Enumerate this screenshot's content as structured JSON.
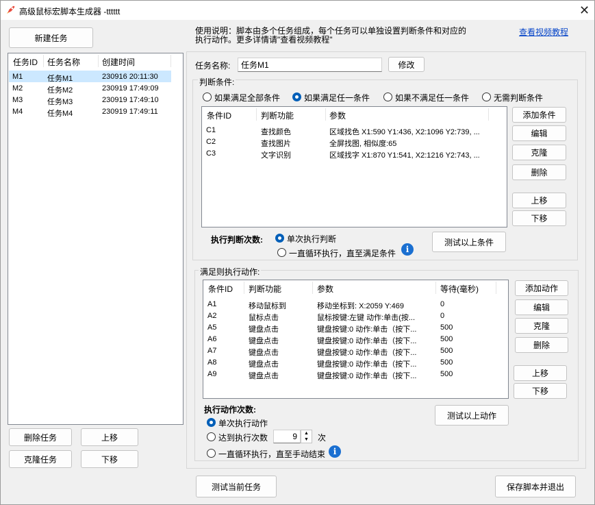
{
  "window": {
    "title": "高级鼠标宏脚本生成器 -tttttt",
    "close": "✕"
  },
  "left": {
    "new_task": "新建任务",
    "columns": [
      "任务ID",
      "任务名称",
      "创建时间"
    ],
    "tasks": [
      {
        "id": "M1",
        "name": "任务M1",
        "time": "230916 20:11:30",
        "selected": true
      },
      {
        "id": "M2",
        "name": "任务M2",
        "time": "230919 17:49:09"
      },
      {
        "id": "M3",
        "name": "任务M3",
        "time": "230919 17:49:10"
      },
      {
        "id": "M4",
        "name": "任务M4",
        "time": "230919 17:49:11"
      }
    ],
    "delete": "删除任务",
    "move_up": "上移",
    "clone": "克隆任务",
    "move_down": "下移"
  },
  "help": {
    "line1": "使用说明：脚本由多个任务组成，每个任务可以单独设置判断条件和对应的",
    "line2": "执行动作。更多详情请\"查看视频教程\"",
    "video_link": "查看视频教程"
  },
  "task": {
    "name_label": "任务名称:",
    "name_value": "任务M1",
    "modify": "修改"
  },
  "conditions": {
    "title": "判断条件:",
    "modes": [
      "如果满足全部条件",
      "如果满足任一条件",
      "如果不满足任一条件",
      "无需判断条件"
    ],
    "selected_mode": 1,
    "columns": [
      "条件ID",
      "判断功能",
      "参数"
    ],
    "rows": [
      {
        "id": "C1",
        "func": "查找颜色",
        "param": "区域找色 X1:590 Y1:436, X2:1096 Y2:739, ..."
      },
      {
        "id": "C2",
        "func": "查找图片",
        "param": "全屏找图, 相似度:65"
      },
      {
        "id": "C3",
        "func": "文字识别",
        "param": "区域找字 X1:870 Y1:541, X2:1216 Y2:743, ..."
      }
    ],
    "add": "添加条件",
    "edit": "编辑",
    "clone": "克隆",
    "delete": "删除",
    "up": "上移",
    "down": "下移",
    "exec_label": "执行判断次数:",
    "exec_once": "单次执行判断",
    "exec_loop": "一直循环执行，直至满足条件",
    "test": "测试以上条件"
  },
  "actions": {
    "title": "满足则执行动作:",
    "columns": [
      "条件ID",
      "判断功能",
      "参数",
      "等待(毫秒)"
    ],
    "rows": [
      {
        "id": "A1",
        "func": "移动鼠标到",
        "param": "移动坐标到: X:2059 Y:469",
        "wait": "0"
      },
      {
        "id": "A2",
        "func": "鼠标点击",
        "param": "鼠标按键:左键 动作:单击(按...",
        "wait": "0"
      },
      {
        "id": "A5",
        "func": "键盘点击",
        "param": "键盘按键:0 动作:单击（按下...",
        "wait": "500"
      },
      {
        "id": "A6",
        "func": "键盘点击",
        "param": "键盘按键:0 动作:单击（按下...",
        "wait": "500"
      },
      {
        "id": "A7",
        "func": "键盘点击",
        "param": "键盘按键:0 动作:单击（按下...",
        "wait": "500"
      },
      {
        "id": "A8",
        "func": "键盘点击",
        "param": "键盘按键:0 动作:单击（按下...",
        "wait": "500"
      },
      {
        "id": "A9",
        "func": "键盘点击",
        "param": "键盘按键:0 动作:单击（按下...",
        "wait": "500"
      }
    ],
    "add": "添加动作",
    "edit": "编辑",
    "clone": "克隆",
    "delete": "删除",
    "up": "上移",
    "down": "下移",
    "exec_label": "执行动作次数:",
    "exec_once": "单次执行动作",
    "exec_count": "达到执行次数",
    "count_value": "9",
    "count_unit": "次",
    "exec_loop": "一直循环执行，直至手动结束",
    "selected_mode": 0,
    "test": "测试以上动作"
  },
  "footer": {
    "test_task": "测试当前任务",
    "save_exit": "保存脚本并退出"
  },
  "colors": {
    "selection": "#cce8ff",
    "accent": "#005fb8",
    "link": "#0645c8",
    "info": "#1a6fd1"
  }
}
